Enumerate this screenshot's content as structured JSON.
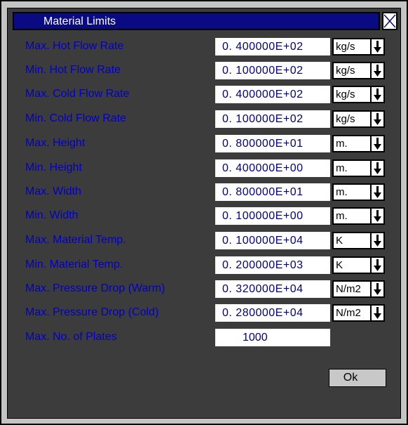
{
  "dialog": {
    "title": "Material Limits",
    "ok_label": "Ok"
  },
  "fields": [
    {
      "label": "Max. Hot Flow Rate",
      "value": "0. 400000E+02",
      "unit": "kg/s"
    },
    {
      "label": "Min. Hot Flow Rate",
      "value": "0. 100000E+02",
      "unit": "kg/s"
    },
    {
      "label": "Max. Cold Flow Rate",
      "value": "0. 400000E+02",
      "unit": "kg/s"
    },
    {
      "label": "Min. Cold Flow Rate",
      "value": "0. 100000E+02",
      "unit": "kg/s"
    },
    {
      "label": "Max. Height",
      "value": "0. 800000E+01",
      "unit": "m."
    },
    {
      "label": "Min. Height",
      "value": "0. 400000E+00",
      "unit": "m."
    },
    {
      "label": "Max. Width",
      "value": "0. 800000E+01",
      "unit": "m."
    },
    {
      "label": "Min. Width",
      "value": "0. 100000E+00",
      "unit": "m."
    },
    {
      "label": "Max. Material Temp.",
      "value": "0. 100000E+04",
      "unit": "K"
    },
    {
      "label": "Min. Material Temp.",
      "value": "0. 200000E+03",
      "unit": "K"
    },
    {
      "label": "Max. Pressure Drop (Warm)",
      "value": "0. 320000E+04",
      "unit": "N/m2"
    },
    {
      "label": "Max. Pressure Drop (Cold)",
      "value": "0. 280000E+04",
      "unit": "N/m2"
    }
  ],
  "plates": {
    "label": "Max. No. of Plates",
    "value": "1000"
  },
  "icons": {
    "close": "close-x-icon",
    "dropdown": "arrow-down-icon"
  },
  "colors": {
    "title_bar": "#0a0a82",
    "label_text": "#0000c8",
    "value_text": "#000080",
    "background": "#3c3c3c"
  }
}
